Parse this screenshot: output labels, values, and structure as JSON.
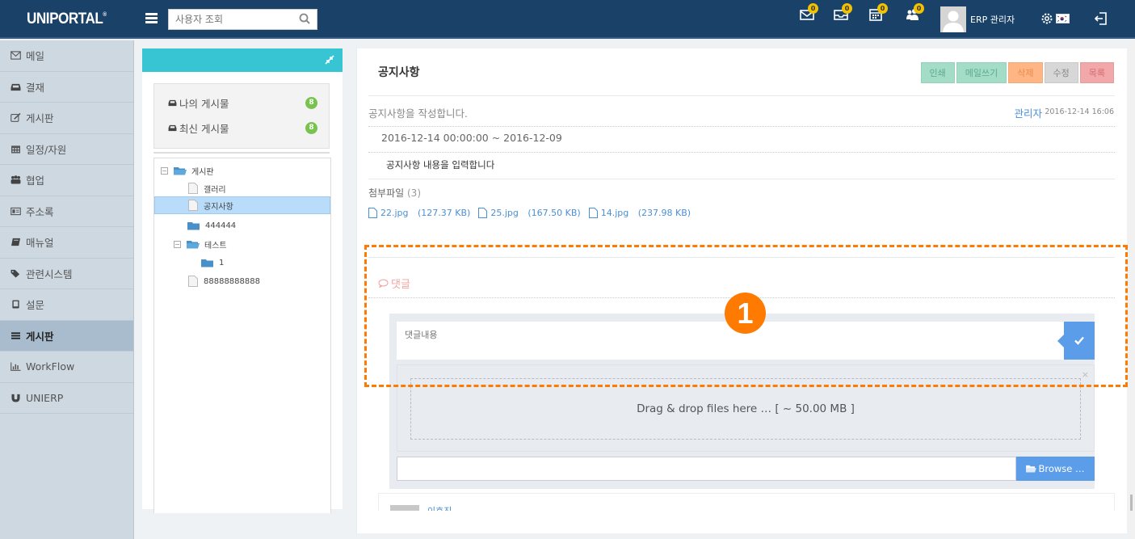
{
  "header": {
    "logo": "UNIPORTAL",
    "logo_mark": "®",
    "search_placeholder": "사용자 조회",
    "notifications": [
      {
        "icon": "mail-icon",
        "count": "0"
      },
      {
        "icon": "approval-icon",
        "count": "0"
      },
      {
        "icon": "calendar-icon",
        "count": "0"
      },
      {
        "icon": "users-icon",
        "count": "0"
      }
    ],
    "user_name": "ERP 관리자"
  },
  "sidebar": {
    "items": [
      {
        "label": "메일",
        "icon": "envelope-icon"
      },
      {
        "label": "결재",
        "icon": "inbox-icon"
      },
      {
        "label": "게시판",
        "icon": "edit-icon"
      },
      {
        "label": "일정/자원",
        "icon": "calendar-icon"
      },
      {
        "label": "협업",
        "icon": "group-icon"
      },
      {
        "label": "주소록",
        "icon": "address-card-icon"
      },
      {
        "label": "매뉴얼",
        "icon": "book-icon"
      },
      {
        "label": "관련시스템",
        "icon": "tags-icon"
      },
      {
        "label": "설문",
        "icon": "tablet-icon"
      },
      {
        "label": "게시판",
        "icon": "list-icon",
        "active": true
      },
      {
        "label": "WorkFlow",
        "icon": "bar-chart-icon"
      },
      {
        "label": "UNIERP",
        "icon": "magnet-icon"
      }
    ]
  },
  "tree_panel": {
    "my_posts": {
      "label": "나의 게시물",
      "count": "8"
    },
    "recent_posts": {
      "label": "최신 게시물",
      "count": "8"
    },
    "nodes": [
      {
        "label": "게시판",
        "type": "folder",
        "expanded": true
      },
      {
        "label": "갤러리",
        "type": "file"
      },
      {
        "label": "공지사항",
        "type": "file",
        "selected": true
      },
      {
        "label": "444444",
        "type": "folder"
      },
      {
        "label": "테스트",
        "type": "folder",
        "expanded": true
      },
      {
        "label": "1",
        "type": "folder"
      },
      {
        "label": "88888888888",
        "type": "file"
      }
    ]
  },
  "main": {
    "title": "공지사항",
    "buttons": {
      "print": "인쇄",
      "mail": "메일쓰기",
      "delete": "삭제",
      "edit": "수정",
      "list": "목록"
    },
    "post": {
      "subject": "공지사항을 작성합니다.",
      "author": "관리자",
      "date": "2016-12-14 16:06",
      "period": "2016-12-14 00:00:00 ~ 2016-12-09",
      "body": "공지사항 내용을 입력합니다"
    },
    "attachments": {
      "label": "첨부파일",
      "count": "(3)",
      "files": [
        {
          "name": "22.jpg",
          "size": "(127.37 KB)"
        },
        {
          "name": "25.jpg",
          "size": "(167.50 KB)"
        },
        {
          "name": "14.jpg",
          "size": "(237.98 KB)"
        }
      ]
    },
    "comments": {
      "title": "댓글",
      "input_placeholder": "댓글내용",
      "drop_text": "Drag & drop files here … [ ~ 50.00 MB ]",
      "drop_close": "×",
      "browse_label": "Browse …",
      "list_first_name": "이효진"
    }
  },
  "annotation": {
    "callout_number": "1",
    "color": "#ff7a00"
  },
  "colors": {
    "header_bg": "#1a4268",
    "tree_header": "#37c4d3",
    "badge": "#77c34d",
    "link": "#4a8fd6",
    "primary_button": "#5b9de8"
  }
}
